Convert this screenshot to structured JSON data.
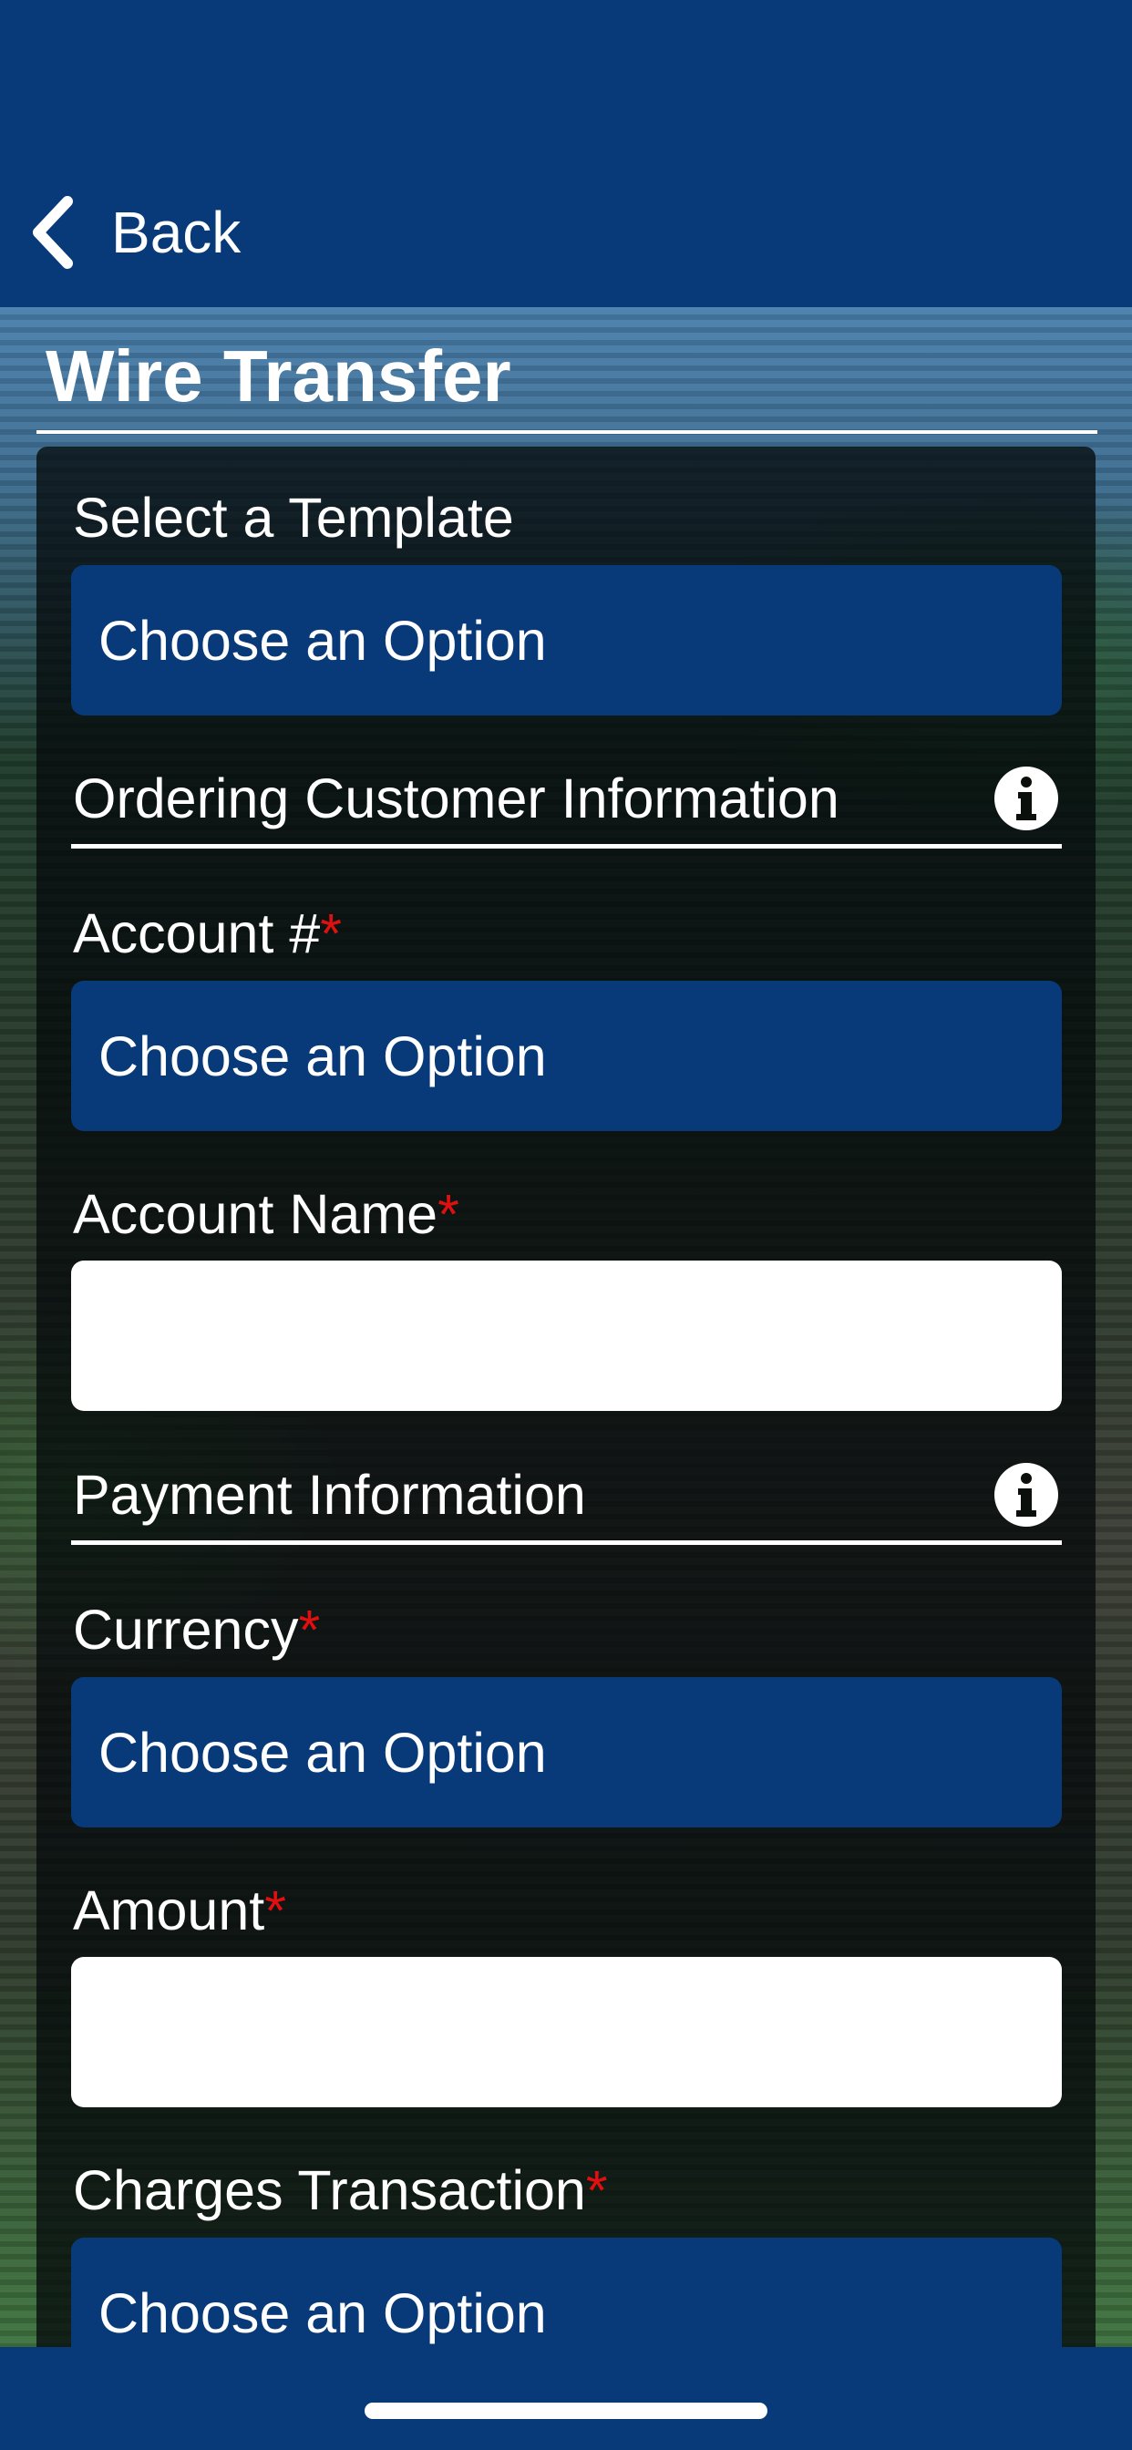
{
  "colors": {
    "brand": "#083a7a",
    "required": "#e01010"
  },
  "nav": {
    "back_label": "Back",
    "back_icon": "chevron-left-icon"
  },
  "page": {
    "title": "Wire Transfer"
  },
  "template": {
    "label": "Select a Template",
    "value": "Choose an Option"
  },
  "ordering_section": {
    "header": "Ordering Customer Information",
    "info_icon": "info-icon",
    "account_number": {
      "label": "Account #",
      "required": "*",
      "value": "Choose an Option"
    },
    "account_name": {
      "label": "Account Name",
      "required": "*",
      "value": ""
    }
  },
  "payment_section": {
    "header": "Payment Information",
    "info_icon": "info-icon",
    "currency": {
      "label": "Currency",
      "required": "*",
      "value": "Choose an Option"
    },
    "amount": {
      "label": "Amount",
      "required": "*",
      "value": ""
    },
    "charges": {
      "label": "Charges Transaction",
      "required": "*",
      "value": "Choose an Option"
    }
  }
}
